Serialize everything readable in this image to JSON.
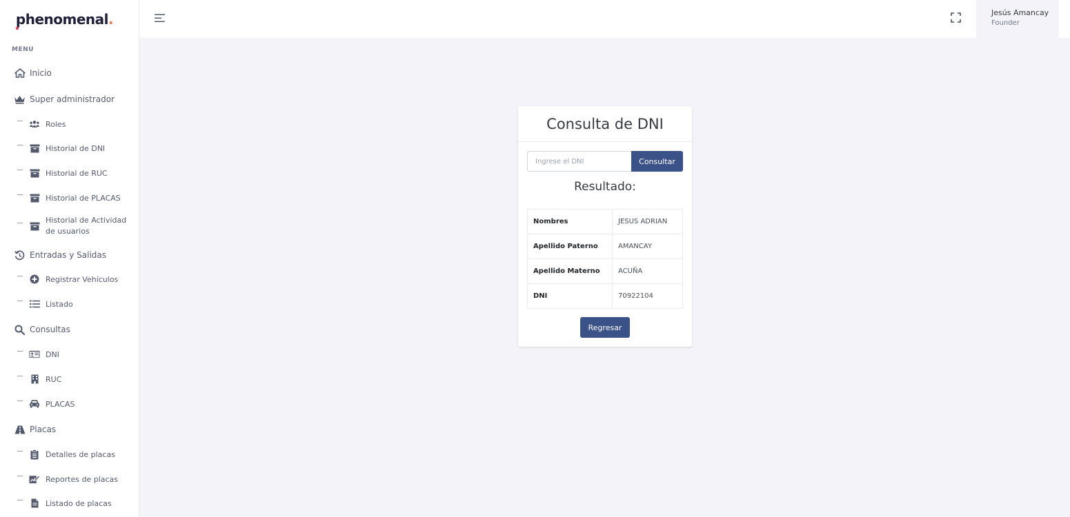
{
  "logo": {
    "text": "phenomenal",
    "dot": "."
  },
  "sidebar": {
    "menu_title": "MENU",
    "items": [
      {
        "label": "Inicio",
        "level": "main",
        "icon": "home-icon"
      },
      {
        "label": "Super administrador",
        "level": "main",
        "icon": "crown-icon"
      },
      {
        "label": "Roles",
        "level": "sub",
        "icon": "users-icon"
      },
      {
        "label": "Historial de DNI",
        "level": "sub",
        "icon": "archive-icon"
      },
      {
        "label": "Historial de RUC",
        "level": "sub",
        "icon": "archive-icon"
      },
      {
        "label": "Historial de PLACAS",
        "level": "sub",
        "icon": "archive-icon"
      },
      {
        "label": "Historial de Actividad de usuarios",
        "level": "sub",
        "icon": "archive-icon"
      },
      {
        "label": "Entradas y Salidas",
        "level": "main",
        "icon": "history-icon"
      },
      {
        "label": "Registrar Vehículos",
        "level": "sub",
        "icon": "plus-circle-icon"
      },
      {
        "label": "Listado",
        "level": "sub",
        "icon": "list-icon"
      },
      {
        "label": "Consultas",
        "level": "main",
        "icon": "search-icon"
      },
      {
        "label": "DNI",
        "level": "sub",
        "icon": "id-card-icon"
      },
      {
        "label": "RUC",
        "level": "sub",
        "icon": "building-icon"
      },
      {
        "label": "PLACAS",
        "level": "sub",
        "icon": "car-icon"
      },
      {
        "label": "Placas",
        "level": "main",
        "icon": "road-icon"
      },
      {
        "label": "Detalles de placas",
        "level": "sub",
        "icon": "clipboard-icon"
      },
      {
        "label": "Reportes de placas",
        "level": "sub",
        "icon": "edit-report-icon"
      },
      {
        "label": "Listado de placas",
        "level": "sub",
        "icon": "file-icon"
      }
    ]
  },
  "header": {
    "user_name": "Jesús Amancay",
    "user_role": "Founder"
  },
  "card": {
    "title": "Consulta de DNI",
    "input_placeholder": "Ingrese el DNI",
    "input_value": "",
    "consultar_label": "Consultar",
    "result_title": "Resultado:",
    "rows": [
      {
        "key": "Nombres",
        "value": "JESUS ADRIAN"
      },
      {
        "key": "Apellido Paterno",
        "value": "AMANCAY"
      },
      {
        "key": "Apellido Materno",
        "value": "ACUÑA"
      },
      {
        "key": "DNI",
        "value": "70922104"
      }
    ],
    "regresar_label": "Regresar"
  },
  "colors": {
    "primary": "#3b5288",
    "background": "#f3f3f9",
    "sidebar_text": "#545a6d"
  }
}
